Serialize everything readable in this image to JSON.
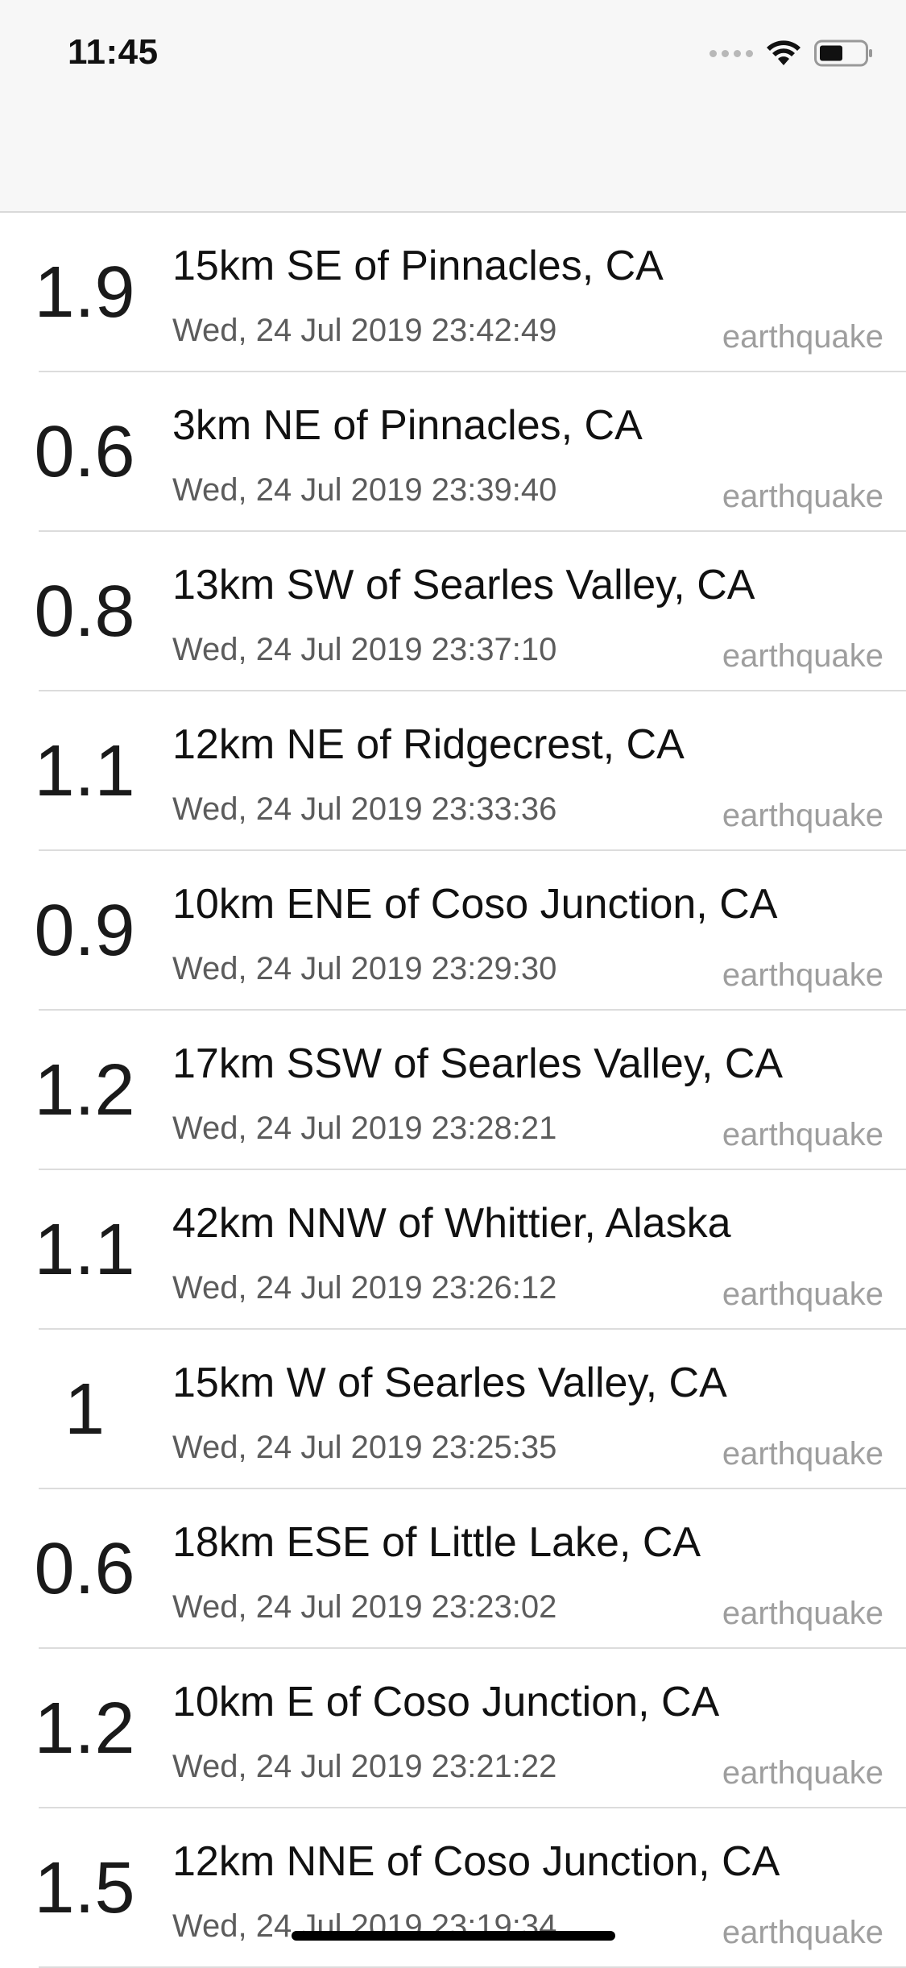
{
  "status_bar": {
    "time": "11:45"
  },
  "earthquakes": [
    {
      "magnitude": "1.9",
      "place": "15km SE of Pinnacles, CA",
      "date": "Wed, 24 Jul 2019 23:42:49",
      "type": "earthquake"
    },
    {
      "magnitude": "0.6",
      "place": "3km NE of Pinnacles, CA",
      "date": "Wed, 24 Jul 2019 23:39:40",
      "type": "earthquake"
    },
    {
      "magnitude": "0.8",
      "place": "13km SW of Searles Valley, CA",
      "date": "Wed, 24 Jul 2019 23:37:10",
      "type": "earthquake"
    },
    {
      "magnitude": "1.1",
      "place": "12km NE of Ridgecrest, CA",
      "date": "Wed, 24 Jul 2019 23:33:36",
      "type": "earthquake"
    },
    {
      "magnitude": "0.9",
      "place": "10km ENE of Coso Junction, CA",
      "date": "Wed, 24 Jul 2019 23:29:30",
      "type": "earthquake"
    },
    {
      "magnitude": "1.2",
      "place": "17km SSW of Searles Valley, CA",
      "date": "Wed, 24 Jul 2019 23:28:21",
      "type": "earthquake"
    },
    {
      "magnitude": "1.1",
      "place": "42km NNW of Whittier, Alaska",
      "date": "Wed, 24 Jul 2019 23:26:12",
      "type": "earthquake"
    },
    {
      "magnitude": "1",
      "place": "15km W of Searles Valley, CA",
      "date": "Wed, 24 Jul 2019 23:25:35",
      "type": "earthquake"
    },
    {
      "magnitude": "0.6",
      "place": "18km ESE of Little Lake, CA",
      "date": "Wed, 24 Jul 2019 23:23:02",
      "type": "earthquake"
    },
    {
      "magnitude": "1.2",
      "place": "10km E of Coso Junction, CA",
      "date": "Wed, 24 Jul 2019 23:21:22",
      "type": "earthquake"
    },
    {
      "magnitude": "1.5",
      "place": "12km NNE of Coso Junction, CA",
      "date": "Wed, 24 Jul 2019 23:19:34",
      "type": "earthquake"
    }
  ],
  "icons": {
    "signal": "cellular-signal-icon",
    "wifi": "wifi-icon",
    "battery": "battery-icon"
  }
}
